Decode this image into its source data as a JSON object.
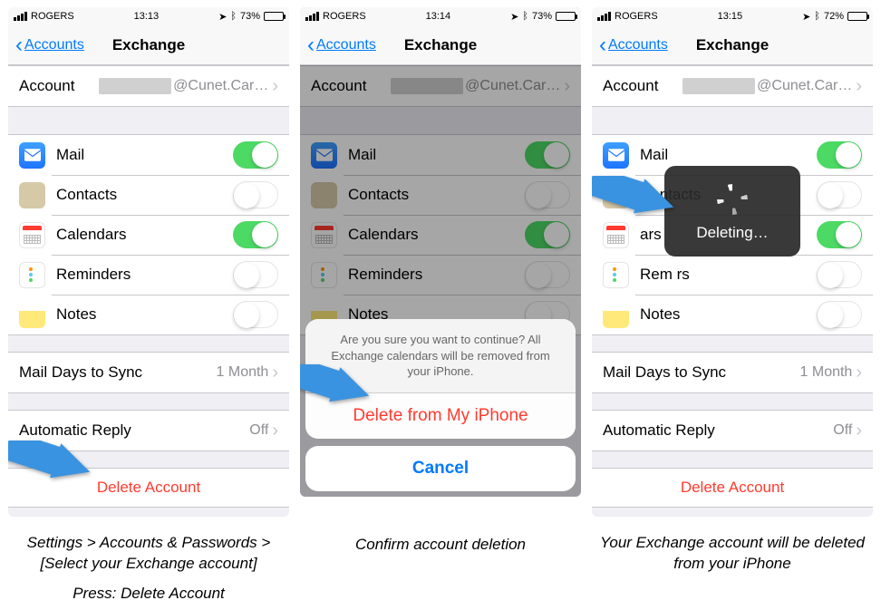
{
  "panel1": {
    "status": {
      "carrier": "ROGERS",
      "time": "13:13",
      "battery_pct": "73%"
    },
    "nav": {
      "back": "Accounts",
      "title": "Exchange"
    },
    "account": {
      "label": "Account",
      "value_suffix": "@Cunet.Car…"
    },
    "services": [
      {
        "name": "Mail",
        "on": true
      },
      {
        "name": "Contacts",
        "on": false
      },
      {
        "name": "Calendars",
        "on": true
      },
      {
        "name": "Reminders",
        "on": false
      },
      {
        "name": "Notes",
        "on": false
      }
    ],
    "sync": {
      "label": "Mail Days to Sync",
      "value": "1 Month"
    },
    "autoreply": {
      "label": "Automatic Reply",
      "value": "Off"
    },
    "delete": "Delete Account",
    "caption_line1": "Settings > Accounts & Passwords > [Select your Exchange account]",
    "caption_line2": "Press: Delete Account"
  },
  "panel2": {
    "status": {
      "carrier": "ROGERS",
      "time": "13:14",
      "battery_pct": "73%"
    },
    "nav": {
      "back": "Accounts",
      "title": "Exchange"
    },
    "account": {
      "label": "Account",
      "value_suffix": "@Cunet.Car…"
    },
    "services": [
      {
        "name": "Mail",
        "on": true
      },
      {
        "name": "Contacts",
        "on": false
      },
      {
        "name": "Calendars",
        "on": true
      },
      {
        "name": "Reminders",
        "on": false
      },
      {
        "name": "Notes",
        "on": false
      }
    ],
    "sheet": {
      "message": "Are you sure you want to continue? All Exchange calendars will be removed from your iPhone.",
      "delete": "Delete from My iPhone",
      "cancel": "Cancel"
    },
    "caption": "Confirm account deletion"
  },
  "panel3": {
    "status": {
      "carrier": "ROGERS",
      "time": "13:15",
      "battery_pct": "72%"
    },
    "nav": {
      "back": "Accounts",
      "title": "Exchange"
    },
    "account": {
      "label": "Account",
      "value_suffix": "@Cunet.Car…"
    },
    "services": [
      {
        "name": "Mail",
        "on": true
      },
      {
        "name": "Contacts",
        "on": false
      },
      {
        "name": "Calendars_partial",
        "display": "ars",
        "on": true
      },
      {
        "name": "Reminders_partial",
        "display": "Rem          rs",
        "on": false
      },
      {
        "name": "Notes_partial",
        "display": "Notes",
        "on": false
      }
    ],
    "sync": {
      "label": "Mail Days to Sync",
      "value": "1 Month"
    },
    "autoreply": {
      "label": "Automatic Reply",
      "value": "Off"
    },
    "delete": "Delete Account",
    "hud": "Deleting…",
    "caption": "Your Exchange account will be deleted from your iPhone"
  }
}
